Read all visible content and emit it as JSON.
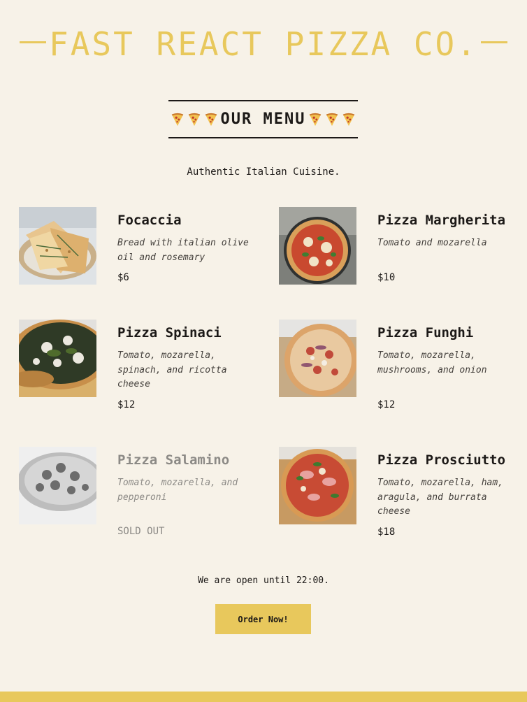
{
  "header": {
    "title": "FAST REACT PIZZA CO."
  },
  "menu": {
    "title": "OUR MENU",
    "tagline": "Authentic Italian Cuisine.",
    "items": [
      {
        "name": "Focaccia",
        "description": "Bread with italian olive oil and rosemary",
        "price": "$6",
        "sold_out": false
      },
      {
        "name": "Pizza Margherita",
        "description": "Tomato and mozarella",
        "price": "$10",
        "sold_out": false
      },
      {
        "name": "Pizza Spinaci",
        "description": "Tomato, mozarella, spinach, and ricotta cheese",
        "price": "$12",
        "sold_out": false
      },
      {
        "name": "Pizza Funghi",
        "description": "Tomato, mozarella, mushrooms, and onion",
        "price": "$12",
        "sold_out": false
      },
      {
        "name": "Pizza Salamino",
        "description": "Tomato, mozarella, and pepperoni",
        "price": "SOLD OUT",
        "sold_out": true
      },
      {
        "name": "Pizza Prosciutto",
        "description": "Tomato, mozarella, ham, aragula, and burrata cheese",
        "price": "$18",
        "sold_out": false
      }
    ]
  },
  "footer": {
    "open_note": "We are open until 22:00.",
    "order_button": "Order Now!"
  },
  "colors": {
    "accent": "#e8c85c",
    "background": "#f7f2e8",
    "text": "#1c1917",
    "sold_out_text": "#8c8a86"
  }
}
